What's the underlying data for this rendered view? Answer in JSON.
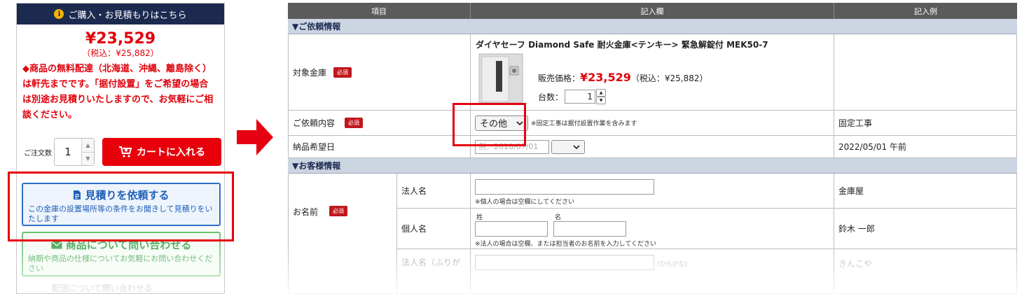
{
  "purchase_panel": {
    "header": "ご購入・お見積もりはこちら",
    "price": "¥23,529",
    "price_tax": "（税込：¥25,882）",
    "notice": "◆商品の無料配達（北海道、沖縄、離島除く）は軒先までです。「据付設置」をご希望の場合は別途お見積りいたしますので、お気軽にご相談ください。",
    "qty_label": "ご注文数",
    "qty_value": "1",
    "cart_button": "カートに入れる",
    "quote_button": {
      "title": "見積りを依頼する",
      "desc": "この金庫の設置場所等の条件をお聞きして見積りをいたします"
    },
    "inquiry_button": {
      "title": "商品について問い合わせる",
      "desc": "納期や商品の仕様についてお気軽にお問い合わせください"
    },
    "faded_text": "配送について問い合わせる"
  },
  "form": {
    "headers": [
      "項目",
      "記入欄",
      "記入例"
    ],
    "section_request": "▼ご依頼情報",
    "section_customer": "▼お客様情報",
    "required": "必須",
    "target_safe": {
      "label": "対象金庫",
      "product_name": "ダイヤセーフ Diamond Safe 耐火金庫<テンキー> 緊急解錠付 MEK50-7",
      "price_label": "販売価格：",
      "price": "¥23,529",
      "price_tax": "（税込：¥25,882）",
      "qty_label": "台数：",
      "qty_value": "1"
    },
    "request_content": {
      "label": "ご依頼内容",
      "selected": "その他",
      "note": "※固定工事は据付設置作業を含みます",
      "example": "固定工事"
    },
    "delivery_date": {
      "label": "納品希望日",
      "placeholder": "例：2018/07/01",
      "example": "2022/05/01 午前"
    },
    "name": {
      "label": "お名前",
      "corp_label": "法人名",
      "corp_note": "※個人の場合は空欄にしてください",
      "corp_example": "金庫屋",
      "person_label": "個人名",
      "last_name_label": "姓",
      "first_name_label": "名",
      "person_note": "※法人の場合は空欄、または担当者のお名前を入力してください",
      "person_example": "鈴木 一郎",
      "kana_label": "法人名（ふりが",
      "kana_hint": "(ひらがな)",
      "kana_example": "きんこや"
    }
  }
}
